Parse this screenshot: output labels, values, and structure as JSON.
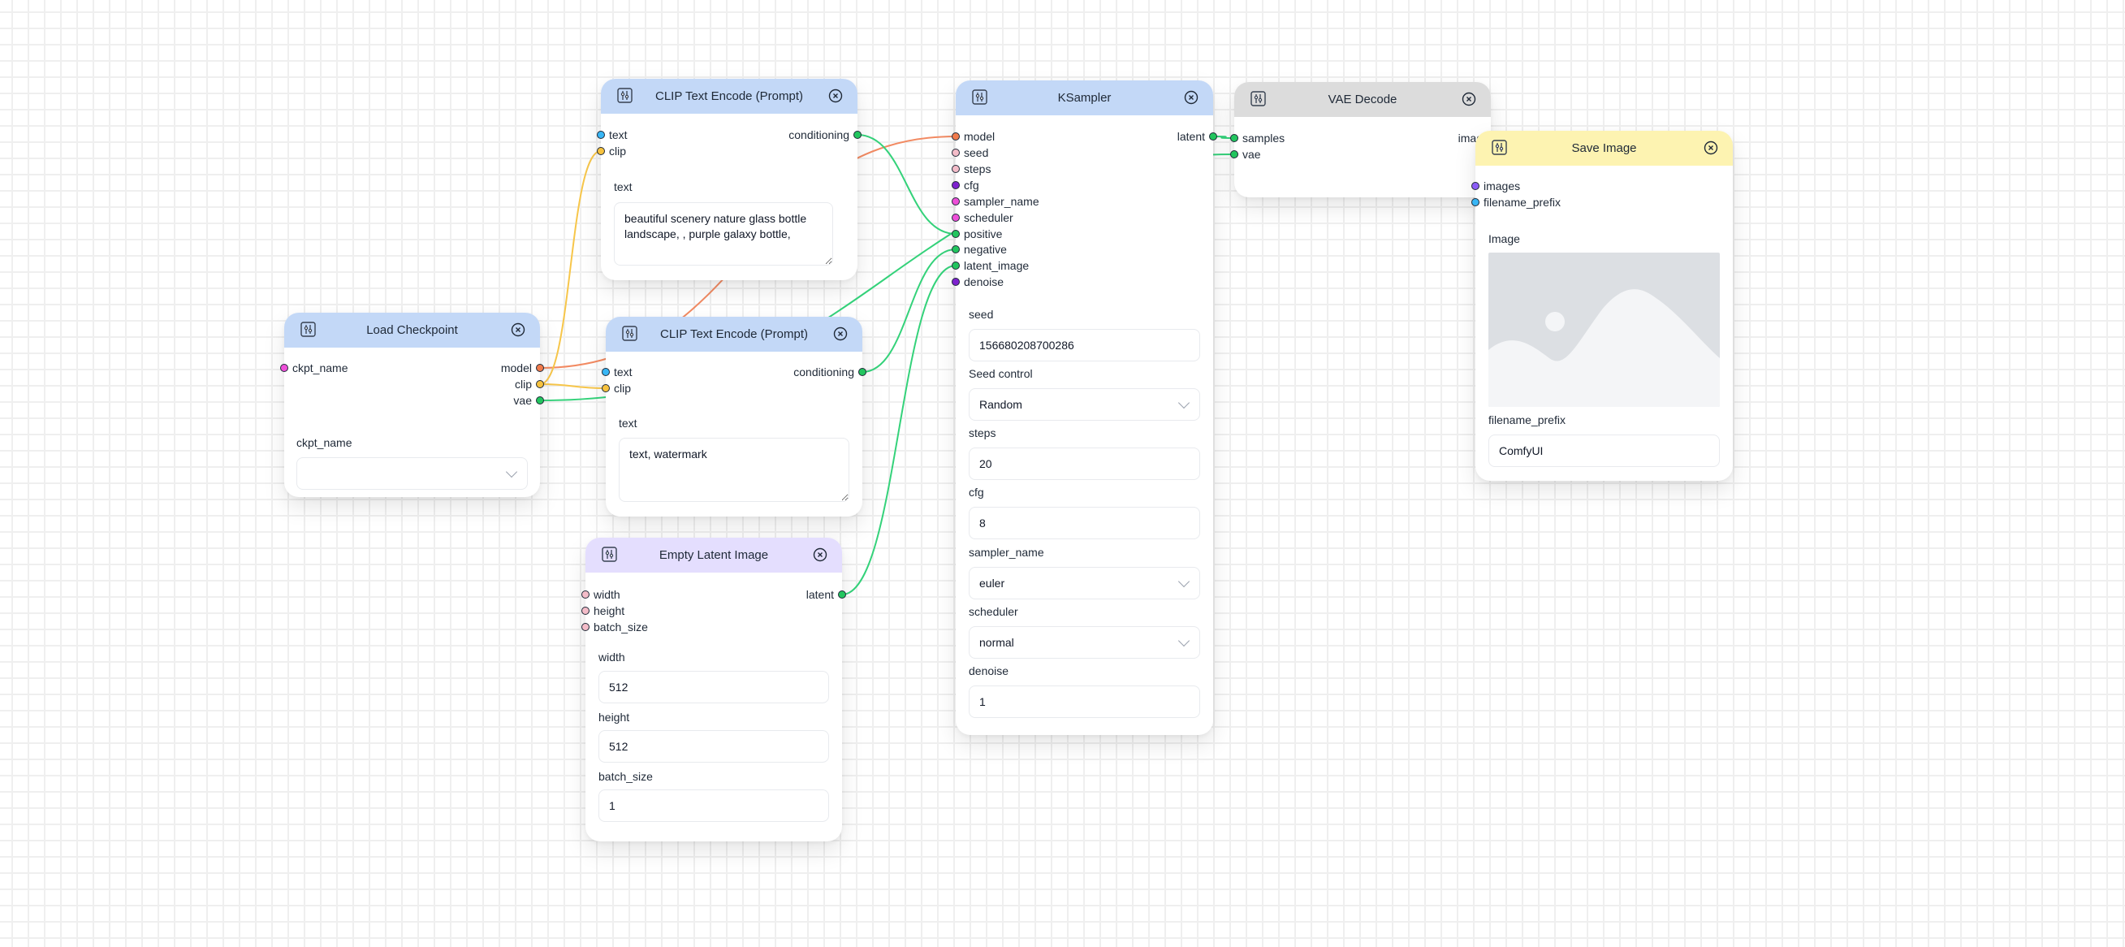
{
  "colors": {
    "blue_header": "#c3d8f7",
    "purple_header": "#e4defe",
    "gray_header": "#dcdcdc",
    "yellow_header": "#fdf3b1",
    "port_model": "#f07a4b",
    "port_clip": "#f7c23e",
    "port_vae": "#22c55e",
    "port_conditioning": "#22c55e",
    "port_latent": "#22c55e",
    "port_text": "#38b6f5",
    "port_int": "#f3bcc8",
    "port_float": "#7e22ce",
    "port_enum": "#ee4fd8",
    "port_image": "#8b5cf6",
    "wire_model": "#f28a62",
    "wire_clip": "#f7c64a",
    "wire_green": "#34d27a"
  },
  "nodes": {
    "load_checkpoint": {
      "title": "Load Checkpoint",
      "inputs": [
        "ckpt_name"
      ],
      "outputs": [
        "model",
        "clip",
        "vae"
      ],
      "fields": {
        "ckpt_name_label": "ckpt_name",
        "ckpt_name_value": ""
      }
    },
    "clip_positive": {
      "title": "CLIP Text Encode (Prompt)",
      "inputs": [
        "text",
        "clip"
      ],
      "outputs": [
        "conditioning"
      ],
      "fields": {
        "text_label": "text",
        "text_value": "beautiful scenery nature glass bottle landscape, , purple galaxy bottle,"
      }
    },
    "clip_negative": {
      "title": "CLIP Text Encode (Prompt)",
      "inputs": [
        "text",
        "clip"
      ],
      "outputs": [
        "conditioning"
      ],
      "fields": {
        "text_label": "text",
        "text_value": "text, watermark"
      }
    },
    "empty_latent": {
      "title": "Empty Latent Image",
      "inputs": [
        "width",
        "height",
        "batch_size"
      ],
      "outputs": [
        "latent"
      ],
      "fields": {
        "width_label": "width",
        "width_value": "512",
        "height_label": "height",
        "height_value": "512",
        "batch_label": "batch_size",
        "batch_value": "1"
      }
    },
    "ksampler": {
      "title": "KSampler",
      "inputs": [
        "model",
        "seed",
        "steps",
        "cfg",
        "sampler_name",
        "scheduler",
        "positive",
        "negative",
        "latent_image",
        "denoise"
      ],
      "outputs": [
        "latent"
      ],
      "fields": {
        "seed_label": "seed",
        "seed_value": "156680208700286",
        "seed_control_label": "Seed control",
        "seed_control_value": "Random",
        "steps_label": "steps",
        "steps_value": "20",
        "cfg_label": "cfg",
        "cfg_value": "8",
        "sampler_label": "sampler_name",
        "sampler_value": "euler",
        "scheduler_label": "scheduler",
        "scheduler_value": "normal",
        "denoise_label": "denoise",
        "denoise_value": "1"
      }
    },
    "vae_decode": {
      "title": "VAE Decode",
      "inputs": [
        "samples",
        "vae"
      ],
      "outputs": [
        "imag"
      ]
    },
    "save_image": {
      "title": "Save Image",
      "inputs": [
        "images",
        "filename_prefix"
      ],
      "outputs": [],
      "fields": {
        "image_label": "Image",
        "filename_prefix_label": "filename_prefix",
        "filename_prefix_value": "ComfyUI"
      }
    }
  },
  "icons": {
    "settings": "sliders-icon",
    "close": "close-circle-icon",
    "image_placeholder": "image-placeholder-icon",
    "dropdown": "chevron-down-icon"
  }
}
